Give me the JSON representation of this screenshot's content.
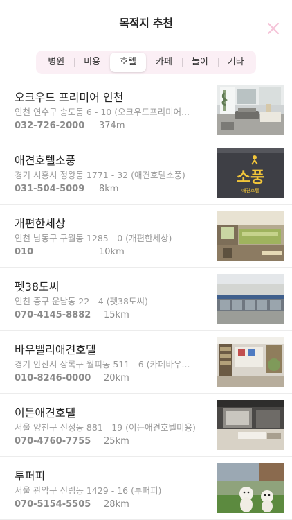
{
  "header": {
    "title": "목적지 추천",
    "close_icon": "close-icon",
    "close_color": "#f5c4d8"
  },
  "tabs": [
    {
      "label": "병원",
      "active": false
    },
    {
      "label": "미용",
      "active": false
    },
    {
      "label": "호텔",
      "active": true
    },
    {
      "label": "카페",
      "active": false
    },
    {
      "label": "놀이",
      "active": false
    },
    {
      "label": "기타",
      "active": false
    }
  ],
  "places": [
    {
      "name": "오크우드 프리미어 인천",
      "address": "인천 연수구 송도동 6 - 10 (오크우드프리미어...",
      "phone": "032-726-2000",
      "distance": "374m",
      "image": "hotel-room-photo"
    },
    {
      "name": "애견호텔소풍",
      "address": "경기 시흥시 정왕동 1771 - 32 (애견호텔소풍)",
      "phone": "031-504-5009",
      "distance": "8km",
      "image": "sopung-logo-photo",
      "image_text": [
        "소풍",
        "애견호텔"
      ]
    },
    {
      "name": "개편한세상",
      "address": "인천 남동구 구월동 1285 - 0 (개편한세상)",
      "phone": "010",
      "distance": "10km",
      "image": "interior-photo"
    },
    {
      "name": "펫38도씨",
      "address": "인천 중구 운남동 22 - 4 (펫38도씨)",
      "phone": "070-4145-8882",
      "distance": "15km",
      "image": "storefront-photo"
    },
    {
      "name": "바우밸리애견호텔",
      "address": "경기 안산시 상록구 월피동 511 - 6 (카페바우...",
      "phone": "010-8246-0000",
      "distance": "20km",
      "image": "shop-interior-photo"
    },
    {
      "name": "이든애견호텔",
      "address": "서울 양천구 신정동 881 - 19 (이든애견호텔미용)",
      "phone": "070-4760-7755",
      "distance": "25km",
      "image": "room-photo"
    },
    {
      "name": "투퍼피",
      "address": "서울 관악구 신림동 1429 - 16 (투퍼피)",
      "phone": "070-5154-5505",
      "distance": "28km",
      "image": "dogs-photo"
    }
  ]
}
